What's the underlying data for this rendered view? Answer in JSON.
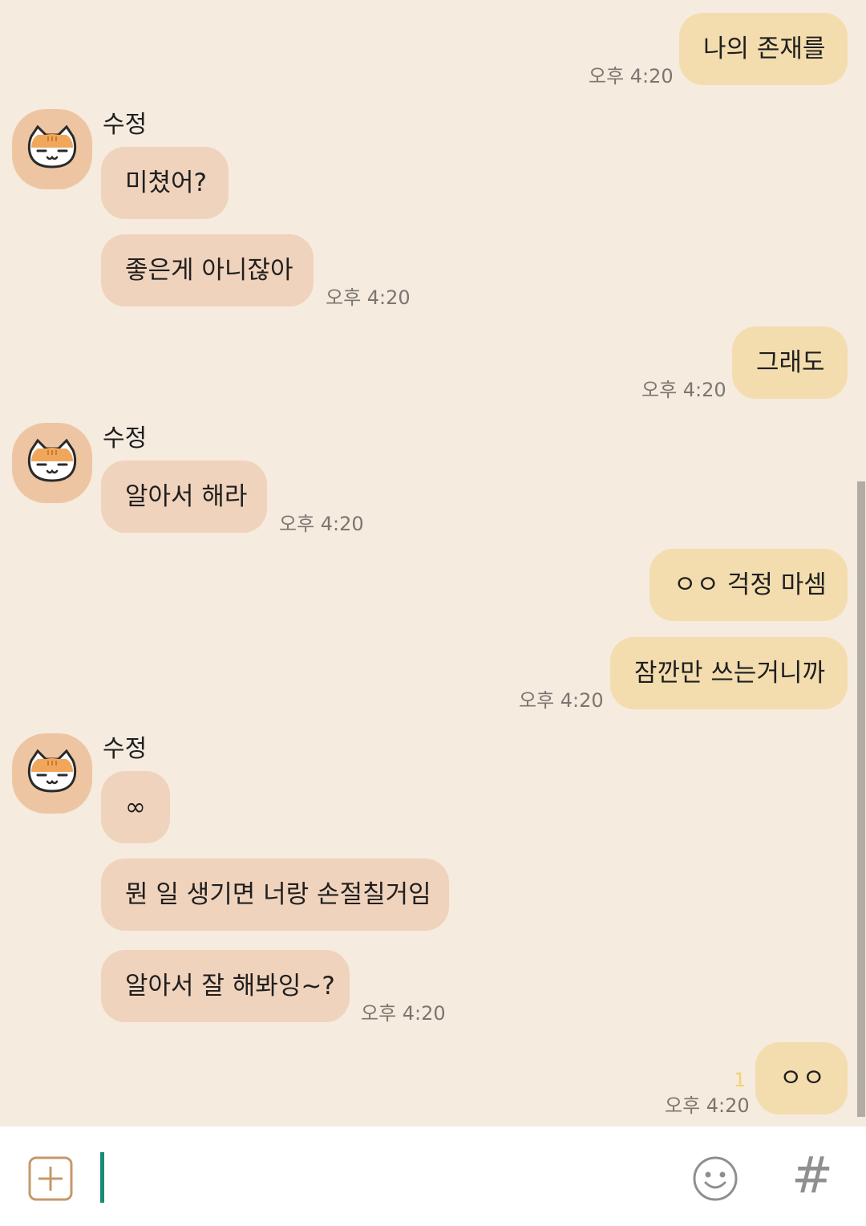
{
  "theme": {
    "my_bubble": "#f3dcae",
    "their_bubble": "#f0d3bd",
    "background": "#f5ebde",
    "cursor": "#1b8a76"
  },
  "messages": [
    {
      "text": "나의 존재를",
      "time": "오후 4:20"
    },
    {
      "sender": "수정",
      "text": "미쳤어?"
    },
    {
      "text": "좋은게 아니잖아",
      "time": "오후 4:20"
    },
    {
      "text": "그래도",
      "time": "오후 4:20"
    },
    {
      "sender": "수정",
      "text": "알아서 해라",
      "time": "오후 4:20"
    },
    {
      "text": "ㅇㅇ 걱정 마셈"
    },
    {
      "text": "잠깐만 쓰는거니까",
      "time": "오후 4:20"
    },
    {
      "sender": "수정",
      "text": "∞"
    },
    {
      "text": "뭔 일 생기면 너랑 손절칠거임"
    },
    {
      "text": "알아서 잘 해봐잉~?",
      "time": "오후 4:20"
    },
    {
      "text": "ㅇㅇ",
      "time": "오후 4:20",
      "unread": "1"
    }
  ],
  "composer": {
    "add_icon": "plus-square-icon",
    "emoji_icon": "smiley-icon",
    "hash_icon": "hash-icon",
    "hash_label": "#"
  }
}
